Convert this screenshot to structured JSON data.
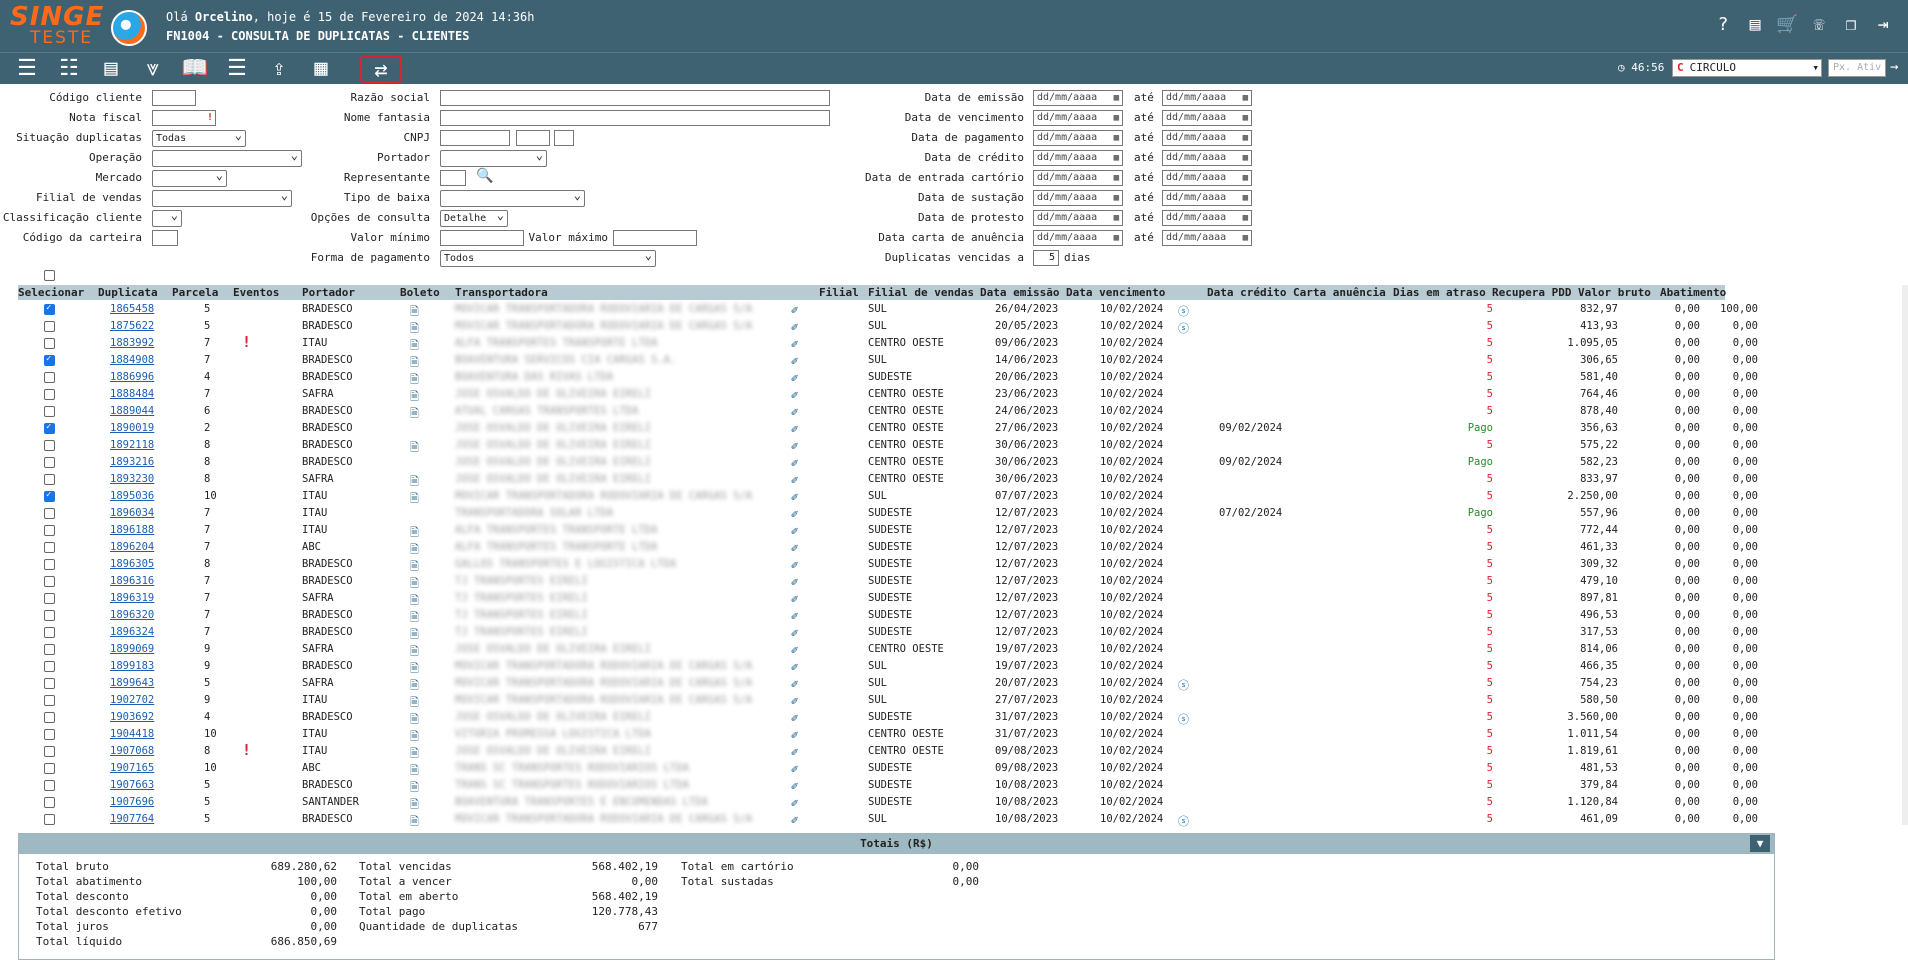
{
  "header": {
    "brand_line1": "SINGE",
    "brand_line2": "TESTE",
    "greeting_prefix": "Olá ",
    "user": "Orcelino",
    "greeting_suffix": ", hoje é 15 de Fevereiro de 2024 14:36h",
    "screen_title": "FN1004 - CONSULTA DE DUPLICATAS - CLIENTES"
  },
  "toolbar": {
    "timer": "46:56",
    "company": "CIRCULO",
    "px_placeholder": "Px. Ativ"
  },
  "filters": {
    "codigo_cliente": "Código cliente",
    "nota_fiscal": "Nota fiscal",
    "situacao": "Situação duplicatas",
    "situacao_value": "Todas",
    "operacao": "Operação",
    "mercado": "Mercado",
    "filial_vendas": "Filial de vendas",
    "classificacao": "Classificação cliente",
    "codigo_carteira": "Código da carteira",
    "razao_social": "Razão social",
    "nome_fantasia": "Nome fantasia",
    "cnpj": "CNPJ",
    "portador": "Portador",
    "representante": "Representante",
    "tipo_baixa": "Tipo de baixa",
    "opcoes_consulta": "Opções de consulta",
    "opcoes_value": "Detalhe",
    "valor_minimo": "Valor mínimo",
    "valor_maximo": "Valor máximo",
    "forma_pagamento": "Forma de pagamento",
    "forma_value": "Todos",
    "ate": "até",
    "date_placeholder": "dd/mm/aaaa",
    "dates": [
      "Data de emissão",
      "Data de vencimento",
      "Data de pagamento",
      "Data de crédito",
      "Data de entrada cartório",
      "Data de sustação",
      "Data de protesto",
      "Data carta de anuência"
    ],
    "vencidas_label": "Duplicatas vencidas a",
    "vencidas_value": "5",
    "vencidas_unit": "dias"
  },
  "table": {
    "headers": [
      "Selecionar",
      "Duplicata",
      "Parcela",
      "Eventos",
      "Portador",
      "Boleto",
      "Transportadora",
      "Filial",
      "Filial de vendas",
      "Data emissão",
      "Data vencimento",
      "Data crédito",
      "Carta anuência",
      "Dias em atraso",
      "Recupera PDD",
      "Valor bruto",
      "Abatimento"
    ],
    "rows": [
      {
        "sel": true,
        "dup": "1865458",
        "parc": "5",
        "alert": false,
        "port": "BRADESCO",
        "boleto": true,
        "transp": "MOVICAR TRANSPORTADORA RODOVIARIA DE CARGAS S/A",
        "fv": "SUL",
        "emi": "26/04/2023",
        "venc": "10/02/2024",
        "info": true,
        "cred": "",
        "atraso": "5",
        "bruto": "832,97",
        "abat": "0,00",
        "x": "100,00"
      },
      {
        "sel": false,
        "dup": "1875622",
        "parc": "5",
        "alert": false,
        "port": "BRADESCO",
        "boleto": true,
        "transp": "MOVICAR TRANSPORTADORA RODOVIARIA DE CARGAS S/A",
        "fv": "SUL",
        "emi": "20/05/2023",
        "venc": "10/02/2024",
        "info": true,
        "cred": "",
        "atraso": "5",
        "bruto": "413,93",
        "abat": "0,00",
        "x": "0,00"
      },
      {
        "sel": false,
        "dup": "1883992",
        "parc": "7",
        "alert": true,
        "port": "ITAU",
        "boleto": true,
        "transp": "ALFA TRANSPORTES TRANSPORTE LTDA",
        "fv": "CENTRO OESTE",
        "emi": "09/06/2023",
        "venc": "10/02/2024",
        "info": false,
        "cred": "",
        "atraso": "5",
        "bruto": "1.095,05",
        "abat": "0,00",
        "x": "0,00"
      },
      {
        "sel": true,
        "dup": "1884908",
        "parc": "7",
        "alert": false,
        "port": "BRADESCO",
        "boleto": true,
        "transp": "BOAVENTURA SERVICOS CIA CARGAS S.A.",
        "fv": "SUL",
        "emi": "14/06/2023",
        "venc": "10/02/2024",
        "info": false,
        "cred": "",
        "atraso": "5",
        "bruto": "306,65",
        "abat": "0,00",
        "x": "0,00"
      },
      {
        "sel": false,
        "dup": "1886996",
        "parc": "4",
        "alert": false,
        "port": "BRADESCO",
        "boleto": true,
        "transp": "BOAVENTURA DAS RIVAS LTDA",
        "fv": "SUDESTE",
        "emi": "20/06/2023",
        "venc": "10/02/2024",
        "info": false,
        "cred": "",
        "atraso": "5",
        "bruto": "581,40",
        "abat": "0,00",
        "x": "0,00"
      },
      {
        "sel": false,
        "dup": "1888484",
        "parc": "7",
        "alert": false,
        "port": "SAFRA",
        "boleto": true,
        "transp": "JOSE OSVALDO DE OLIVEIRA EIRELI",
        "fv": "CENTRO OESTE",
        "emi": "23/06/2023",
        "venc": "10/02/2024",
        "info": false,
        "cred": "",
        "atraso": "5",
        "bruto": "764,46",
        "abat": "0,00",
        "x": "0,00"
      },
      {
        "sel": false,
        "dup": "1889044",
        "parc": "6",
        "alert": false,
        "port": "BRADESCO",
        "boleto": true,
        "transp": "ATUAL CARGAS TRANSPORTES LTDA",
        "fv": "CENTRO OESTE",
        "emi": "24/06/2023",
        "venc": "10/02/2024",
        "info": false,
        "cred": "",
        "atraso": "5",
        "bruto": "878,40",
        "abat": "0,00",
        "x": "0,00"
      },
      {
        "sel": true,
        "dup": "1890019",
        "parc": "2",
        "alert": false,
        "port": "BRADESCO",
        "boleto": false,
        "transp": "JOSE OSVALDO DE OLIVEIRA EIRELI",
        "fv": "CENTRO OESTE",
        "emi": "27/06/2023",
        "venc": "10/02/2024",
        "info": false,
        "cred": "09/02/2024",
        "atraso": "Pago",
        "bruto": "356,63",
        "abat": "0,00",
        "x": "0,00"
      },
      {
        "sel": false,
        "dup": "1892118",
        "parc": "8",
        "alert": false,
        "port": "BRADESCO",
        "boleto": true,
        "transp": "JOSE OSVALDO DE OLIVEIRA EIRELI",
        "fv": "CENTRO OESTE",
        "emi": "30/06/2023",
        "venc": "10/02/2024",
        "info": false,
        "cred": "",
        "atraso": "5",
        "bruto": "575,22",
        "abat": "0,00",
        "x": "0,00"
      },
      {
        "sel": false,
        "dup": "1893216",
        "parc": "8",
        "alert": false,
        "port": "BRADESCO",
        "boleto": false,
        "transp": "JOSE OSVALDO DE OLIVEIRA EIRELI",
        "fv": "CENTRO OESTE",
        "emi": "30/06/2023",
        "venc": "10/02/2024",
        "info": false,
        "cred": "09/02/2024",
        "atraso": "Pago",
        "bruto": "582,23",
        "abat": "0,00",
        "x": "0,00"
      },
      {
        "sel": false,
        "dup": "1893230",
        "parc": "8",
        "alert": false,
        "port": "SAFRA",
        "boleto": true,
        "transp": "JOSE OSVALDO DE OLIVEIRA EIRELI",
        "fv": "CENTRO OESTE",
        "emi": "30/06/2023",
        "venc": "10/02/2024",
        "info": false,
        "cred": "",
        "atraso": "5",
        "bruto": "833,97",
        "abat": "0,00",
        "x": "0,00"
      },
      {
        "sel": true,
        "dup": "1895036",
        "parc": "10",
        "alert": false,
        "port": "ITAU",
        "boleto": true,
        "transp": "MOVICAR TRANSPORTADORA RODOVIARIA DE CARGAS S/A",
        "fv": "SUL",
        "emi": "07/07/2023",
        "venc": "10/02/2024",
        "info": false,
        "cred": "",
        "atraso": "5",
        "bruto": "2.250,00",
        "abat": "0,00",
        "x": "0,00"
      },
      {
        "sel": false,
        "dup": "1896034",
        "parc": "7",
        "alert": false,
        "port": "ITAU",
        "boleto": false,
        "transp": "TRANSPORTADORA SOLAR LTDA",
        "fv": "SUDESTE",
        "emi": "12/07/2023",
        "venc": "10/02/2024",
        "info": false,
        "cred": "07/02/2024",
        "atraso": "Pago",
        "bruto": "557,96",
        "abat": "0,00",
        "x": "0,00"
      },
      {
        "sel": false,
        "dup": "1896188",
        "parc": "7",
        "alert": false,
        "port": "ITAU",
        "boleto": true,
        "transp": "ALFA TRANSPORTES TRANSPORTE LTDA",
        "fv": "SUDESTE",
        "emi": "12/07/2023",
        "venc": "10/02/2024",
        "info": false,
        "cred": "",
        "atraso": "5",
        "bruto": "772,44",
        "abat": "0,00",
        "x": "0,00"
      },
      {
        "sel": false,
        "dup": "1896204",
        "parc": "7",
        "alert": false,
        "port": "ABC",
        "boleto": true,
        "transp": "ALFA TRANSPORTES TRANSPORTE LTDA",
        "fv": "SUDESTE",
        "emi": "12/07/2023",
        "venc": "10/02/2024",
        "info": false,
        "cred": "",
        "atraso": "5",
        "bruto": "461,33",
        "abat": "0,00",
        "x": "0,00"
      },
      {
        "sel": false,
        "dup": "1896305",
        "parc": "8",
        "alert": false,
        "port": "BRADESCO",
        "boleto": true,
        "transp": "GALLOS TRANSPORTES E LOGISTICA LTDA",
        "fv": "SUDESTE",
        "emi": "12/07/2023",
        "venc": "10/02/2024",
        "info": false,
        "cred": "",
        "atraso": "5",
        "bruto": "309,32",
        "abat": "0,00",
        "x": "0,00"
      },
      {
        "sel": false,
        "dup": "1896316",
        "parc": "7",
        "alert": false,
        "port": "BRADESCO",
        "boleto": true,
        "transp": "TJ TRANSPORTES EIRELI",
        "fv": "SUDESTE",
        "emi": "12/07/2023",
        "venc": "10/02/2024",
        "info": false,
        "cred": "",
        "atraso": "5",
        "bruto": "479,10",
        "abat": "0,00",
        "x": "0,00"
      },
      {
        "sel": false,
        "dup": "1896319",
        "parc": "7",
        "alert": false,
        "port": "SAFRA",
        "boleto": true,
        "transp": "TJ TRANSPORTES EIRELI",
        "fv": "SUDESTE",
        "emi": "12/07/2023",
        "venc": "10/02/2024",
        "info": false,
        "cred": "",
        "atraso": "5",
        "bruto": "897,81",
        "abat": "0,00",
        "x": "0,00"
      },
      {
        "sel": false,
        "dup": "1896320",
        "parc": "7",
        "alert": false,
        "port": "BRADESCO",
        "boleto": true,
        "transp": "TJ TRANSPORTES EIRELI",
        "fv": "SUDESTE",
        "emi": "12/07/2023",
        "venc": "10/02/2024",
        "info": false,
        "cred": "",
        "atraso": "5",
        "bruto": "496,53",
        "abat": "0,00",
        "x": "0,00"
      },
      {
        "sel": false,
        "dup": "1896324",
        "parc": "7",
        "alert": false,
        "port": "BRADESCO",
        "boleto": true,
        "transp": "TJ TRANSPORTES EIRELI",
        "fv": "SUDESTE",
        "emi": "12/07/2023",
        "venc": "10/02/2024",
        "info": false,
        "cred": "",
        "atraso": "5",
        "bruto": "317,53",
        "abat": "0,00",
        "x": "0,00"
      },
      {
        "sel": false,
        "dup": "1899069",
        "parc": "9",
        "alert": false,
        "port": "SAFRA",
        "boleto": true,
        "transp": "JOSE OSVALDO DE OLIVEIRA EIRELI",
        "fv": "CENTRO OESTE",
        "emi": "19/07/2023",
        "venc": "10/02/2024",
        "info": false,
        "cred": "",
        "atraso": "5",
        "bruto": "814,06",
        "abat": "0,00",
        "x": "0,00"
      },
      {
        "sel": false,
        "dup": "1899183",
        "parc": "9",
        "alert": false,
        "port": "BRADESCO",
        "boleto": true,
        "transp": "MOVICAR TRANSPORTADORA RODOVIARIA DE CARGAS S/A",
        "fv": "SUL",
        "emi": "19/07/2023",
        "venc": "10/02/2024",
        "info": false,
        "cred": "",
        "atraso": "5",
        "bruto": "466,35",
        "abat": "0,00",
        "x": "0,00"
      },
      {
        "sel": false,
        "dup": "1899643",
        "parc": "5",
        "alert": false,
        "port": "SAFRA",
        "boleto": true,
        "transp": "MOVICAR TRANSPORTADORA RODOVIARIA DE CARGAS S/A",
        "fv": "SUL",
        "emi": "20/07/2023",
        "venc": "10/02/2024",
        "info": true,
        "cred": "",
        "atraso": "5",
        "bruto": "754,23",
        "abat": "0,00",
        "x": "0,00"
      },
      {
        "sel": false,
        "dup": "1902702",
        "parc": "9",
        "alert": false,
        "port": "ITAU",
        "boleto": true,
        "transp": "MOVICAR TRANSPORTADORA RODOVIARIA DE CARGAS S/A",
        "fv": "SUL",
        "emi": "27/07/2023",
        "venc": "10/02/2024",
        "info": false,
        "cred": "",
        "atraso": "5",
        "bruto": "580,50",
        "abat": "0,00",
        "x": "0,00"
      },
      {
        "sel": false,
        "dup": "1903692",
        "parc": "4",
        "alert": false,
        "port": "BRADESCO",
        "boleto": true,
        "transp": "JOSE OSVALDO DE OLIVEIRA EIRELI",
        "fv": "SUDESTE",
        "emi": "31/07/2023",
        "venc": "10/02/2024",
        "info": true,
        "cred": "",
        "atraso": "5",
        "bruto": "3.560,00",
        "abat": "0,00",
        "x": "0,00"
      },
      {
        "sel": false,
        "dup": "1904418",
        "parc": "10",
        "alert": false,
        "port": "ITAU",
        "boleto": true,
        "transp": "VITORIA PROMESSA LOGISTICA LTDA",
        "fv": "CENTRO OESTE",
        "emi": "31/07/2023",
        "venc": "10/02/2024",
        "info": false,
        "cred": "",
        "atraso": "5",
        "bruto": "1.011,54",
        "abat": "0,00",
        "x": "0,00"
      },
      {
        "sel": false,
        "dup": "1907068",
        "parc": "8",
        "alert": true,
        "port": "ITAU",
        "boleto": true,
        "transp": "JOSE OSVALDO DE OLIVEIRA EIRELI",
        "fv": "CENTRO OESTE",
        "emi": "09/08/2023",
        "venc": "10/02/2024",
        "info": false,
        "cred": "",
        "atraso": "5",
        "bruto": "1.819,61",
        "abat": "0,00",
        "x": "0,00"
      },
      {
        "sel": false,
        "dup": "1907165",
        "parc": "10",
        "alert": false,
        "port": "ABC",
        "boleto": true,
        "transp": "TRANS SC TRANSPORTES RODOVIARIOS LTDA",
        "fv": "SUDESTE",
        "emi": "09/08/2023",
        "venc": "10/02/2024",
        "info": false,
        "cred": "",
        "atraso": "5",
        "bruto": "481,53",
        "abat": "0,00",
        "x": "0,00"
      },
      {
        "sel": false,
        "dup": "1907663",
        "parc": "5",
        "alert": false,
        "port": "BRADESCO",
        "boleto": true,
        "transp": "TRANS SC TRANSPORTES RODOVIARIOS LTDA",
        "fv": "SUDESTE",
        "emi": "10/08/2023",
        "venc": "10/02/2024",
        "info": false,
        "cred": "",
        "atraso": "5",
        "bruto": "379,84",
        "abat": "0,00",
        "x": "0,00"
      },
      {
        "sel": false,
        "dup": "1907696",
        "parc": "5",
        "alert": false,
        "port": "SANTANDER",
        "boleto": true,
        "transp": "BOAVENTURA TRANSPORTES E ENCOMENDAS LTDA",
        "fv": "SUDESTE",
        "emi": "10/08/2023",
        "venc": "10/02/2024",
        "info": false,
        "cred": "",
        "atraso": "5",
        "bruto": "1.120,84",
        "abat": "0,00",
        "x": "0,00"
      },
      {
        "sel": false,
        "dup": "1907764",
        "parc": "5",
        "alert": false,
        "port": "BRADESCO",
        "boleto": true,
        "transp": "MOVICAR TRANSPORTADORA RODOVIARIA DE CARGAS S/A",
        "fv": "SUL",
        "emi": "10/08/2023",
        "venc": "10/02/2024",
        "info": true,
        "cred": "",
        "atraso": "5",
        "bruto": "461,09",
        "abat": "0,00",
        "x": "0,00"
      }
    ]
  },
  "totals": {
    "title": "Totais (R$)",
    "col1": [
      {
        "label": "Total bruto",
        "value": "689.280,62"
      },
      {
        "label": "Total abatimento",
        "value": "100,00"
      },
      {
        "label": "Total desconto",
        "value": "0,00"
      },
      {
        "label": "Total desconto efetivo",
        "value": "0,00"
      },
      {
        "label": "Total juros",
        "value": "0,00"
      },
      {
        "label": "Total líquido",
        "value": "686.850,69"
      }
    ],
    "col2": [
      {
        "label": "Total vencidas",
        "value": "568.402,19"
      },
      {
        "label": "Total a vencer",
        "value": "0,00"
      },
      {
        "label": "Total em aberto",
        "value": "568.402,19"
      },
      {
        "label": "Total pago",
        "value": "120.778,43"
      },
      {
        "label": "Quantidade de duplicatas",
        "value": "677"
      }
    ],
    "col3": [
      {
        "label": "Total em cartório",
        "value": "0,00"
      },
      {
        "label": "Total sustadas",
        "value": "0,00"
      }
    ]
  }
}
